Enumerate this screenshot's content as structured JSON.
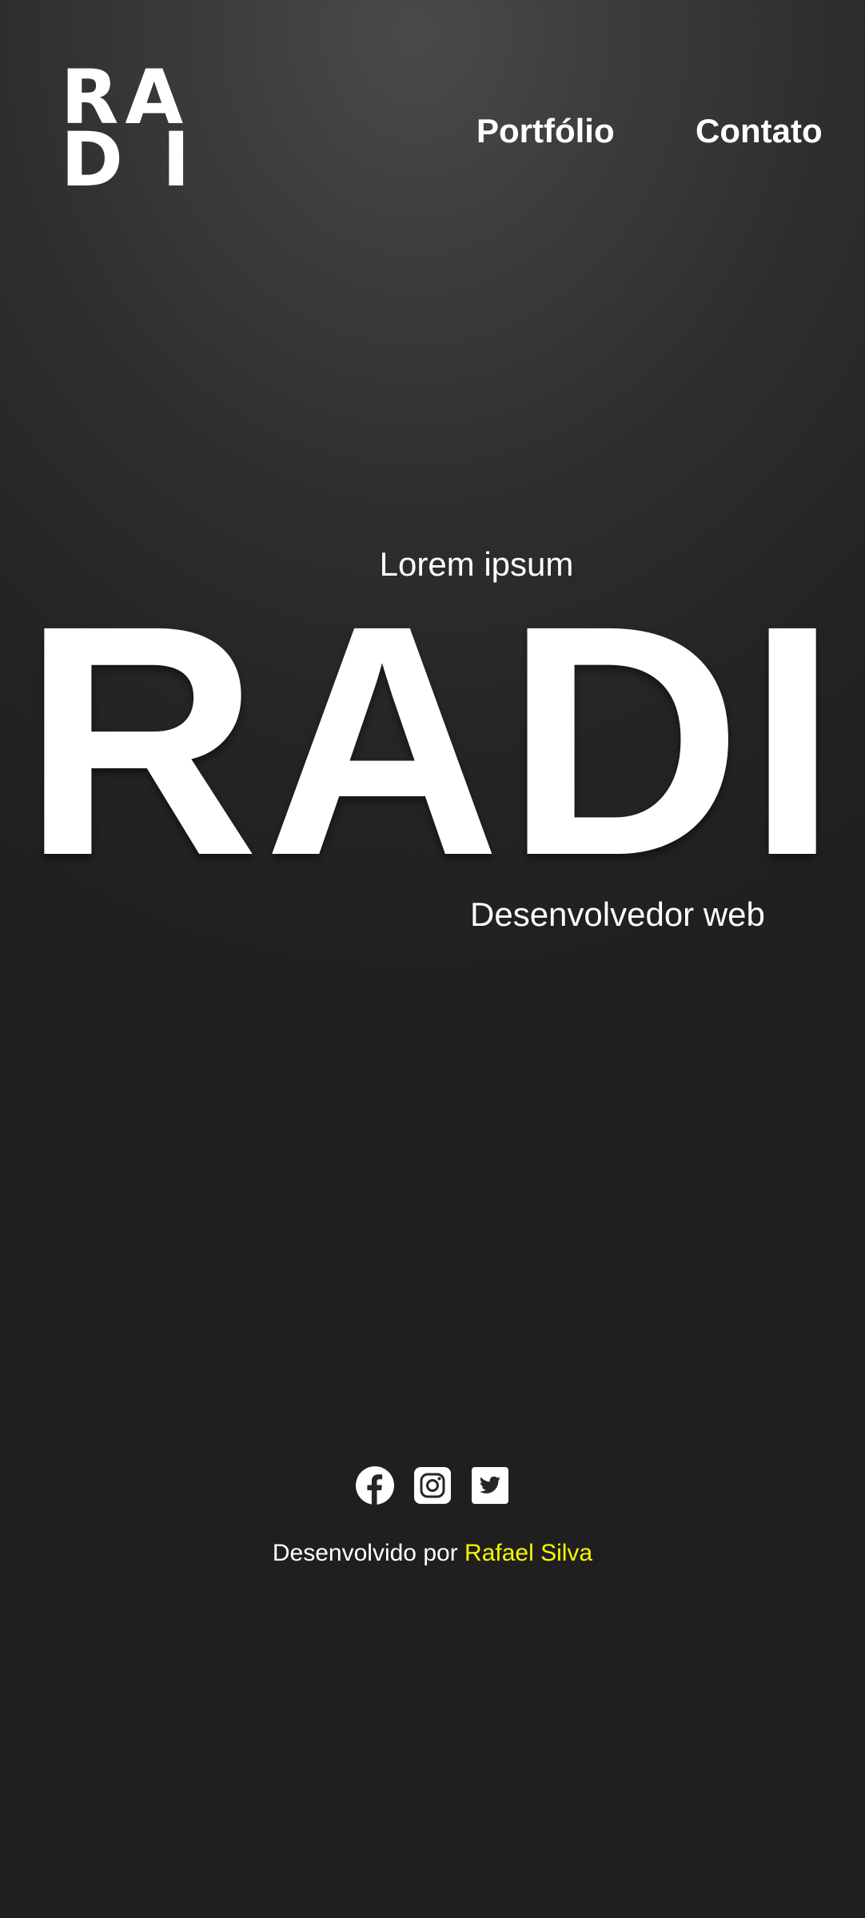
{
  "header": {
    "logo_line1": "RA",
    "logo_line2": "DI",
    "nav": [
      {
        "label": "Portfólio"
      },
      {
        "label": "Contato"
      }
    ]
  },
  "hero": {
    "pretitle": "Lorem ipsum",
    "title": "RADI",
    "subtitle": "Desenvolvedor web"
  },
  "social": {
    "icons": [
      "facebook-icon",
      "instagram-icon",
      "twitter-icon"
    ]
  },
  "footer": {
    "prefix": "Desenvolvido por ",
    "author": "Rafael Silva"
  },
  "colors": {
    "background": "#1f1f1f",
    "text": "#ffffff",
    "accent": "#f7f700"
  }
}
